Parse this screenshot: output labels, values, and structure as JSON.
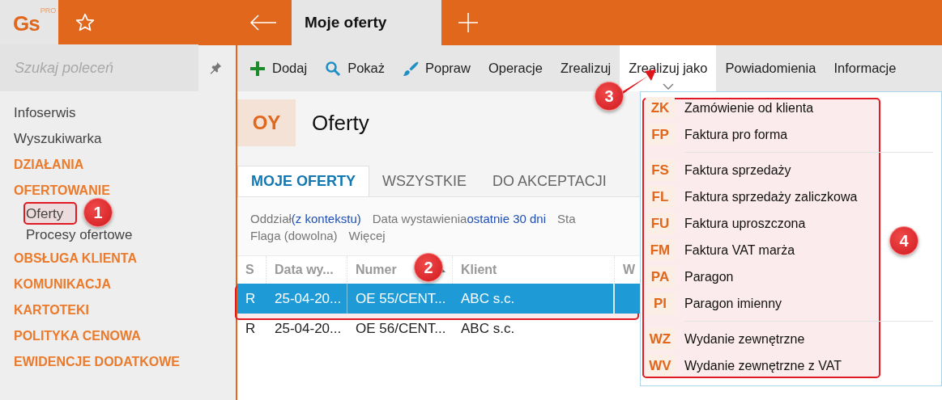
{
  "app": {
    "logo": "Gs",
    "logo_badge": "PRO"
  },
  "top_tabs": [
    {
      "label": "Moje oferty",
      "selected": true
    }
  ],
  "sidebar": {
    "search": {
      "placeholder": "Szukaj poleceń"
    },
    "items": [
      {
        "label": "Infoserwis",
        "kind": "link"
      },
      {
        "label": "Wyszukiwarka",
        "kind": "link"
      },
      {
        "label": "DZIAŁANIA",
        "kind": "section"
      },
      {
        "label": "OFERTOWANIE",
        "kind": "section",
        "children": [
          {
            "label": "Oferty"
          },
          {
            "label": "Procesy ofertowe"
          }
        ]
      },
      {
        "label": "OBSŁUGA KLIENTA",
        "kind": "section"
      },
      {
        "label": "KOMUNIKACJA",
        "kind": "section"
      },
      {
        "label": "KARTOTEKI",
        "kind": "section"
      },
      {
        "label": "POLITYKA CENOWA",
        "kind": "section"
      },
      {
        "label": "EWIDENCJE DODATKOWE",
        "kind": "section"
      }
    ]
  },
  "toolbar": [
    {
      "label": "Dodaj",
      "kind": "add",
      "open": false
    },
    {
      "label": "Pokaż",
      "kind": "show",
      "open": false
    },
    {
      "label": "Popraw",
      "kind": "edit",
      "open": false
    },
    {
      "label": "Operacje",
      "kind": "text",
      "open": false
    },
    {
      "label": "Zrealizuj",
      "kind": "text",
      "open": false
    },
    {
      "label": "Zrealizuj jako",
      "kind": "text",
      "open": true
    },
    {
      "label": "Powiadomienia",
      "kind": "text",
      "open": false
    },
    {
      "label": "Informacje",
      "kind": "text",
      "open": false
    }
  ],
  "page": {
    "badge": "OY",
    "title": "Oferty"
  },
  "tabs": [
    {
      "label": "MOJE OFERTY",
      "selected": true
    },
    {
      "label": "WSZYSTKIE",
      "selected": false
    },
    {
      "label": "DO AKCEPTACJI",
      "selected": false
    }
  ],
  "filters": [
    [
      {
        "label": "Oddział",
        "value": "(z kontekstu)"
      },
      {
        "label": "Data wystawienia",
        "value": "ostatnie 30 dni"
      },
      {
        "label": "Sta"
      }
    ],
    [
      {
        "label": "Flaga (dowolna)"
      },
      {
        "label": "Więcej"
      }
    ]
  ],
  "table": {
    "columns": [
      {
        "label": "S"
      },
      {
        "label": "Data wy..."
      },
      {
        "label": "Numer",
        "sorted": true
      },
      {
        "label": "Klient"
      },
      {
        "label": "W"
      }
    ],
    "rows": [
      {
        "cells": [
          "R",
          "25-04-20...",
          "OE 55/CENT...",
          "ABC s.c."
        ],
        "selected": true
      },
      {
        "cells": [
          "R",
          "25-04-20...",
          "OE 56/CENT...",
          "ABC s.c."
        ],
        "selected": false
      }
    ]
  },
  "dropdown": {
    "groups": [
      [
        {
          "code": "ZK",
          "label": "Zamówienie od klienta"
        },
        {
          "code": "FP",
          "label": "Faktura pro forma"
        }
      ],
      [
        {
          "code": "FS",
          "label": "Faktura sprzedaży"
        },
        {
          "code": "FL",
          "label": "Faktura sprzedaży zaliczkowa"
        },
        {
          "code": "FU",
          "label": "Faktura uproszczona"
        },
        {
          "code": "FM",
          "label": "Faktura VAT marża"
        },
        {
          "code": "PA",
          "label": "Paragon"
        },
        {
          "code": "PI",
          "label": "Paragon imienny"
        }
      ],
      [
        {
          "code": "WZ",
          "label": "Wydanie zewnętrzne"
        },
        {
          "code": "WV",
          "label": "Wydanie zewnętrzne z VAT"
        }
      ]
    ]
  },
  "callouts": [
    "1",
    "2",
    "3",
    "4"
  ]
}
